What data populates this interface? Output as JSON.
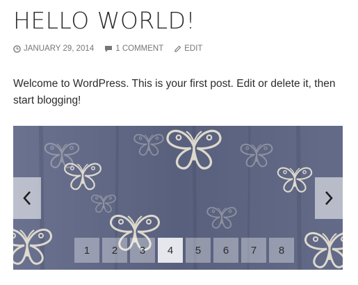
{
  "post": {
    "title": "HELLO WORLD!",
    "meta": {
      "date": "JANUARY 29, 2014",
      "date_icon": "clock-icon",
      "comments": "1 COMMENT",
      "comments_icon": "speech-bubble-icon",
      "edit": "EDIT",
      "edit_icon": "pencil-icon"
    },
    "content": "Welcome to WordPress. This is your first post. Edit or delete it, then start blogging!"
  },
  "gallery": {
    "prev_icon": "chevron-left-icon",
    "next_icon": "chevron-right-icon",
    "pages": [
      "1",
      "2",
      "3",
      "4",
      "5",
      "6",
      "7",
      "8"
    ],
    "active_page": "4",
    "colors": {
      "background": "#5d6683",
      "pattern": "#ece6d6"
    }
  }
}
